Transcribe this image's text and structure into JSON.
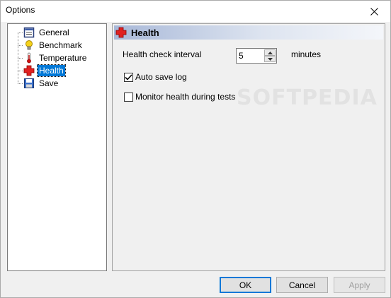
{
  "window": {
    "title": "Options"
  },
  "tree": {
    "items": [
      {
        "label": "General",
        "icon": "general-icon"
      },
      {
        "label": "Benchmark",
        "icon": "lightbulb-icon"
      },
      {
        "label": "Temperature",
        "icon": "thermometer-icon"
      },
      {
        "label": "Health",
        "icon": "red-cross-icon",
        "selected": true
      },
      {
        "label": "Save",
        "icon": "floppy-disk-icon"
      }
    ]
  },
  "panel": {
    "title": "Health",
    "interval_label": "Health check interval",
    "interval_value": "5",
    "interval_unit": "minutes",
    "auto_save_label": "Auto save log",
    "auto_save_checked": true,
    "monitor_label": "Monitor health during tests",
    "monitor_checked": false
  },
  "watermark": "SOFTPEDIA",
  "buttons": {
    "ok": "OK",
    "cancel": "Cancel",
    "apply": "Apply"
  },
  "colors": {
    "selection": "#0078d7",
    "health_red": "#e02020"
  }
}
